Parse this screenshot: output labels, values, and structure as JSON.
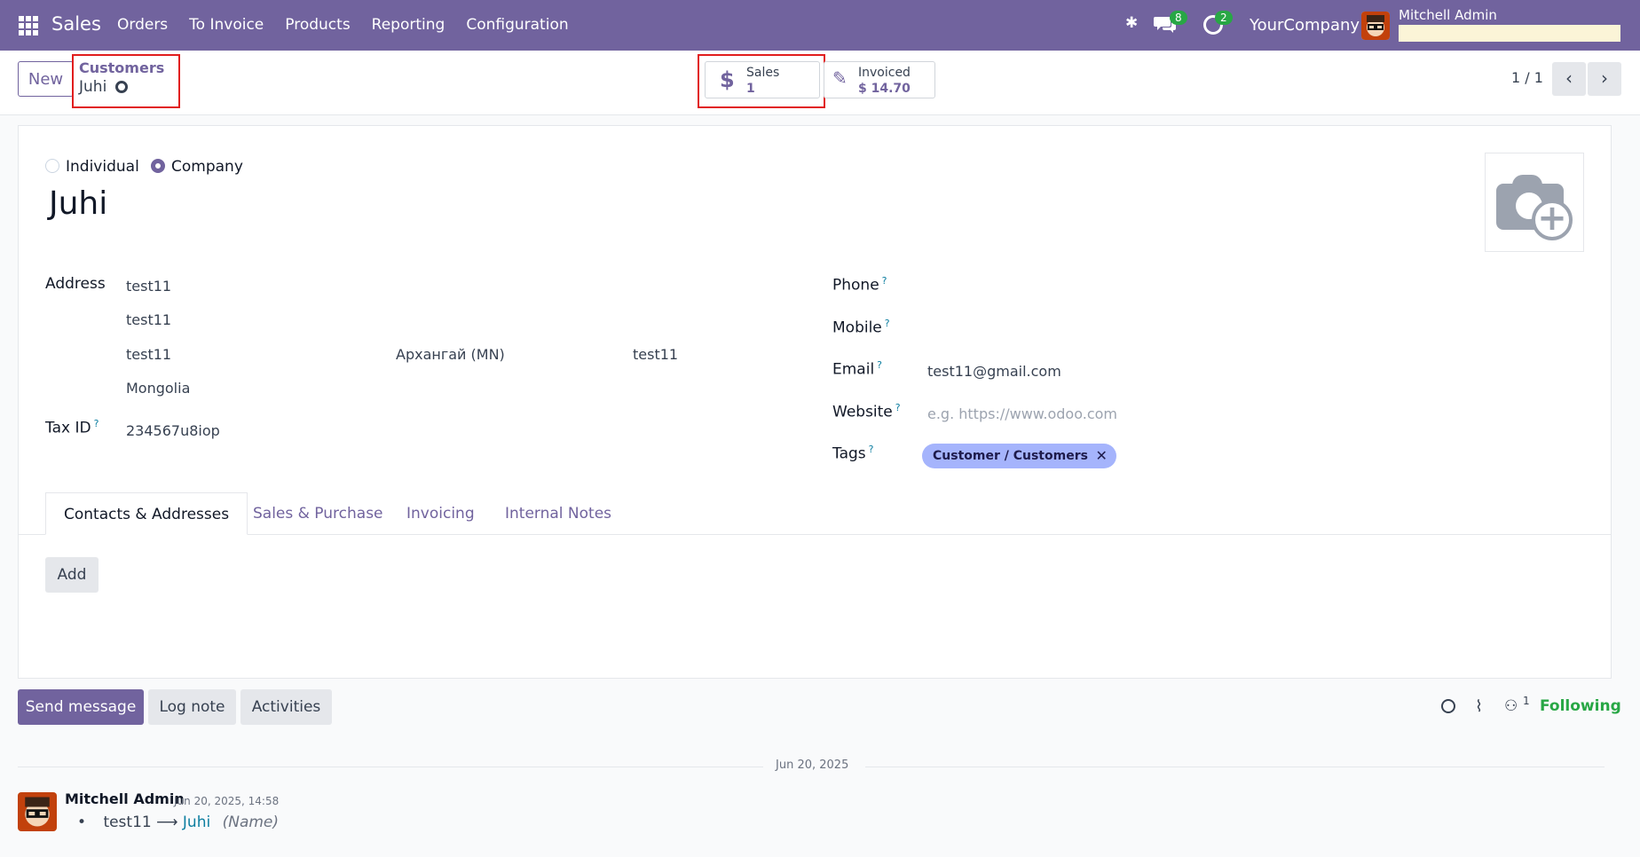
{
  "navbar": {
    "app_name": "Sales",
    "menu": [
      "Orders",
      "To Invoice",
      "Products",
      "Reporting",
      "Configuration"
    ],
    "messages_count": "8",
    "activities_count": "2",
    "company": "YourCompany",
    "user": "Mitchell Admin"
  },
  "control": {
    "new_label": "New",
    "breadcrumb_parent": "Customers",
    "breadcrumb_current": "Juhi",
    "stat_sales_label": "Sales",
    "stat_sales_value": "1",
    "stat_invoiced_label": "Invoiced",
    "stat_invoiced_value": "$ 14.70",
    "pager": "1 / 1"
  },
  "form": {
    "type_individual": "Individual",
    "type_company": "Company",
    "selected_type": "Company",
    "name": "Juhi",
    "address_label": "Address",
    "street": "test11",
    "street2": "test11",
    "city": "test11",
    "state": "Архангай (MN)",
    "zip": "test11",
    "country": "Mongolia",
    "tax_id_label": "Tax ID",
    "tax_id": "234567u8iop",
    "phone_label": "Phone",
    "mobile_label": "Mobile",
    "email_label": "Email",
    "email": "test11@gmail.com",
    "website_label": "Website",
    "website_placeholder": "e.g. https://www.odoo.com",
    "tags_label": "Tags",
    "tag": "Customer / Customers"
  },
  "tabs": [
    "Contacts & Addresses",
    "Sales & Purchase",
    "Invoicing",
    "Internal Notes"
  ],
  "add_label": "Add",
  "chatter": {
    "send_message": "Send message",
    "log_note": "Log note",
    "activities": "Activities",
    "followers_count": "1",
    "following": "Following",
    "date": "Jun 20, 2025",
    "author": "Mitchell Admin",
    "timestamp": "Jun 20, 2025, 14:58",
    "old_value": "test11",
    "new_value": "Juhi",
    "field": "(Name)"
  },
  "colors": {
    "brand": "#71639e",
    "highlight": "#e11d1d",
    "success": "#28a745"
  }
}
